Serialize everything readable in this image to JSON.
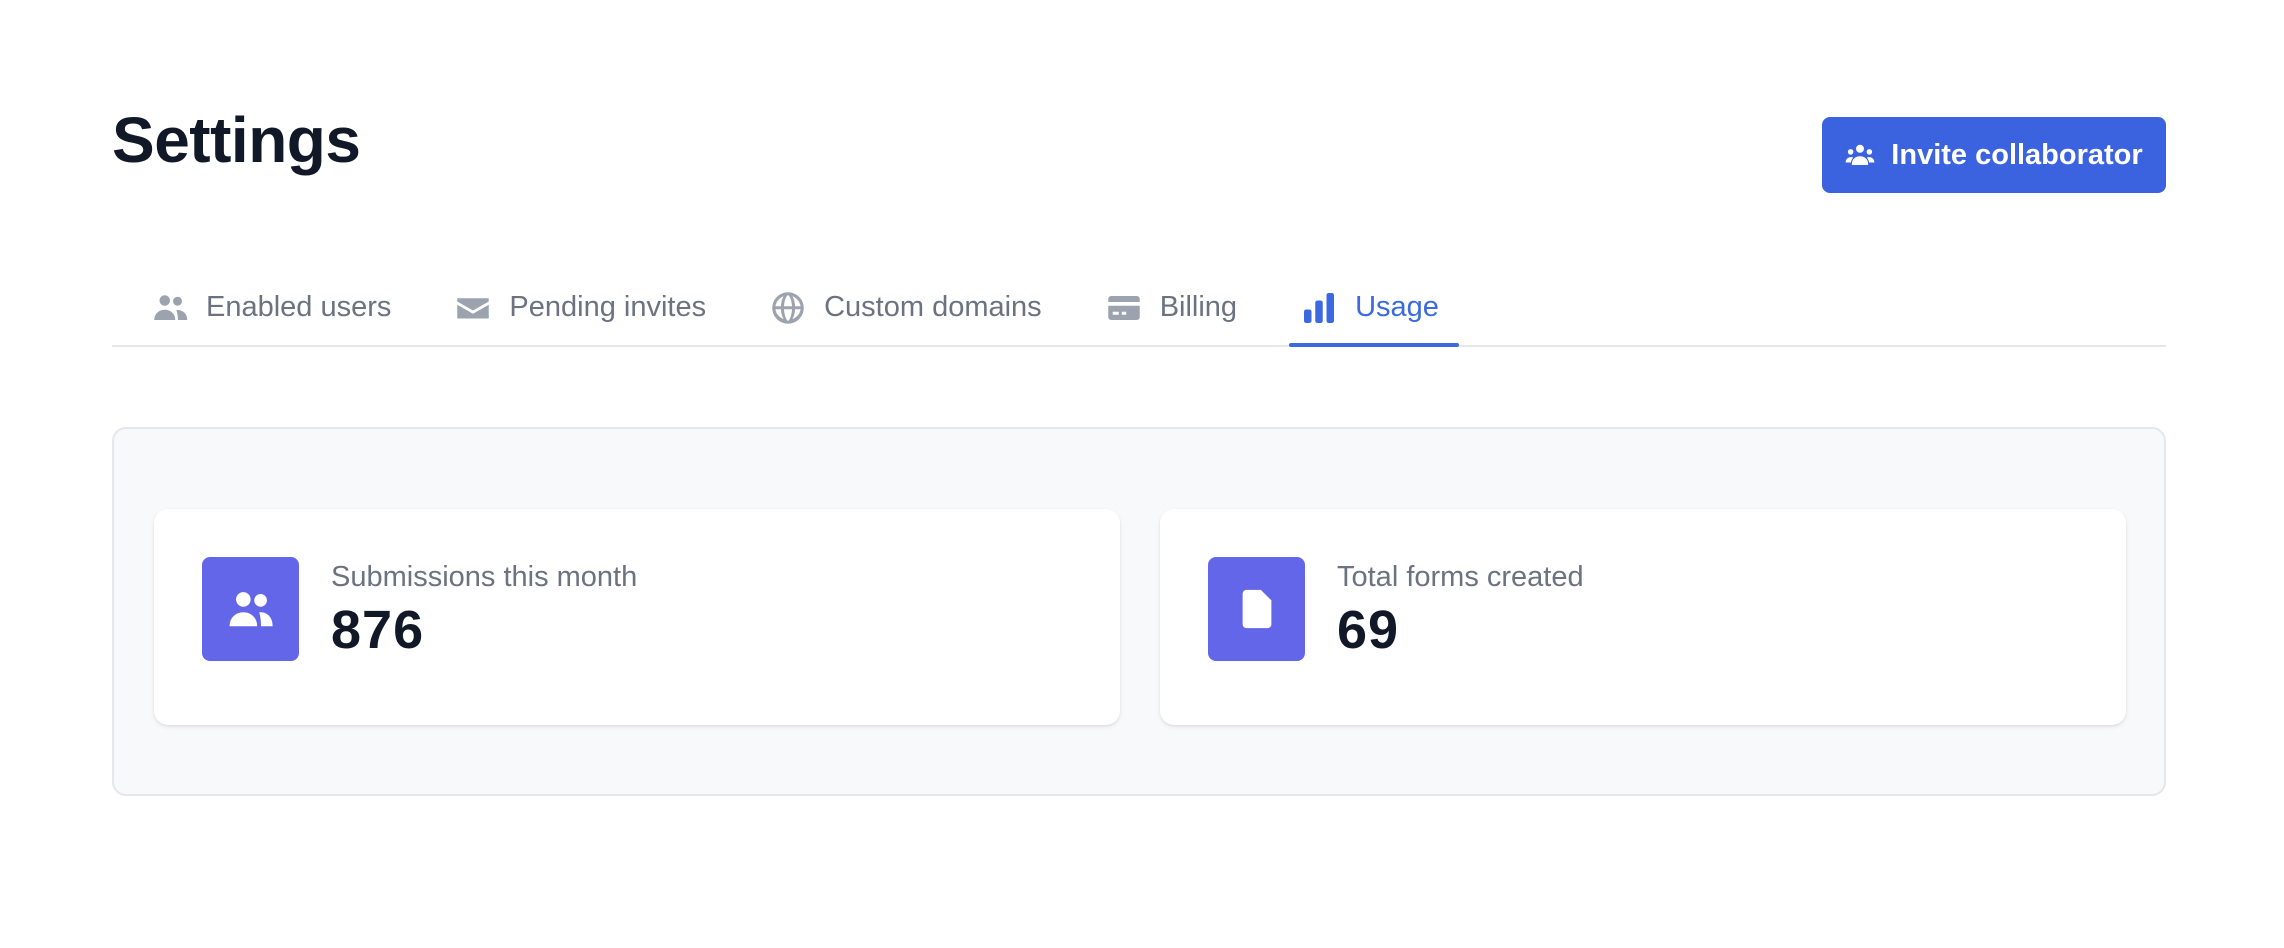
{
  "page": {
    "title": "Settings"
  },
  "header": {
    "invite_button": {
      "label": "Invite collaborator",
      "icon": "users-icon"
    }
  },
  "tabs": [
    {
      "label": "Enabled users",
      "icon": "users-icon",
      "active": false
    },
    {
      "label": "Pending invites",
      "icon": "envelope-icon",
      "active": false
    },
    {
      "label": "Custom domains",
      "icon": "globe-icon",
      "active": false
    },
    {
      "label": "Billing",
      "icon": "credit-card-icon",
      "active": false
    },
    {
      "label": "Usage",
      "icon": "bar-chart-icon",
      "active": true
    }
  ],
  "stats": [
    {
      "label": "Submissions this month",
      "value": "876",
      "icon": "users-icon"
    },
    {
      "label": "Total forms created",
      "value": "69",
      "icon": "document-icon"
    }
  ],
  "colors": {
    "primary_button": "#3b63e0",
    "active_tab": "#3b6ae0",
    "stat_icon_bg": "#6366e8",
    "muted_text": "#6b7280"
  }
}
